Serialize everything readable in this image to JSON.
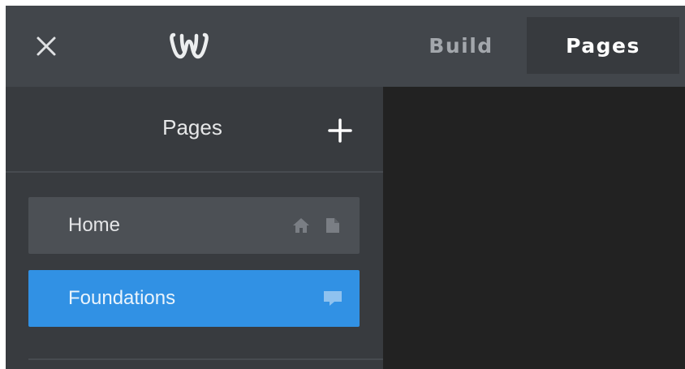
{
  "topbar": {
    "close_icon": "close-icon",
    "logo_icon": "weebly-logo-icon",
    "tabs": [
      {
        "label": "Build",
        "active": false
      },
      {
        "label": "Pages",
        "active": true
      }
    ]
  },
  "sidebar": {
    "title": "Pages",
    "add_icon": "plus-icon",
    "items": [
      {
        "label": "Home",
        "icons": [
          "home-icon",
          "page-icon"
        ],
        "selected": false
      },
      {
        "label": "Foundations",
        "icons": [
          "comment-icon"
        ],
        "selected": true
      }
    ]
  },
  "colors": {
    "topbar_bg": "#42464b",
    "active_tab_bg": "#373a3e",
    "sidebar_bg": "#383b3f",
    "item_bg": "#4c5055",
    "selected_item_bg": "#3191e4",
    "canvas_bg": "#222222"
  }
}
